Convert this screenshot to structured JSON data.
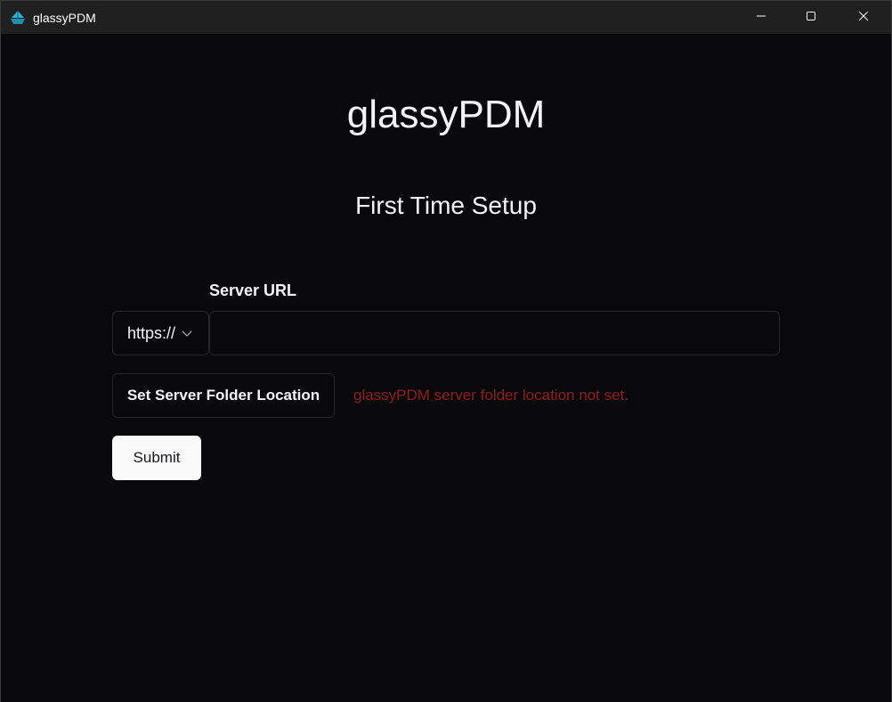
{
  "window": {
    "title": "glassyPDM",
    "icon": "boat-icon",
    "controls": {
      "minimize": "minimize-icon",
      "maximize": "maximize-icon",
      "close": "close-icon"
    }
  },
  "main": {
    "app_title": "glassyPDM",
    "setup_title": "First Time Setup",
    "server_url": {
      "label": "Server URL",
      "protocol_selected": "https://",
      "value": "",
      "placeholder": ""
    },
    "folder_button_label": "Set Server Folder Location",
    "folder_status": "glassyPDM server folder location not set.",
    "submit_label": "Submit"
  },
  "colors": {
    "background": "#09090b",
    "titlebar": "#202020",
    "text": "#f4f4f5",
    "error": "#8f1d1d",
    "border": "#27272a",
    "icon_accent": "#2bb3d4"
  }
}
